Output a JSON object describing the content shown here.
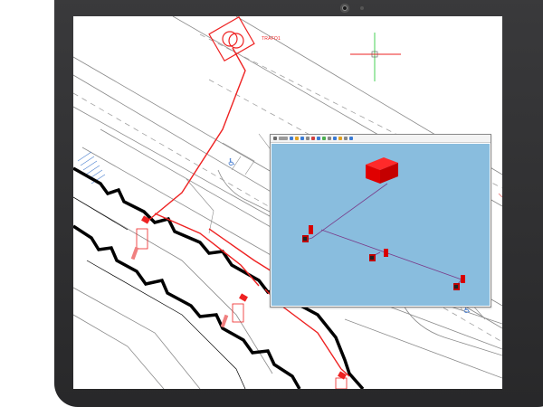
{
  "drawing": {
    "transformer_label": "TRAFO1"
  },
  "colors": {
    "device_frame": "#2f2f31",
    "cable_route": "#ee2222",
    "building_outline": "#000000",
    "viewer_background": "#89bdde",
    "parking_symbol": "#4a7fd0"
  },
  "icons": {
    "camera": "camera-icon",
    "crosshair": "crosshair-icon",
    "transformer": "transformer-symbol-icon",
    "accessible_parking": "wheelchair-icon"
  }
}
